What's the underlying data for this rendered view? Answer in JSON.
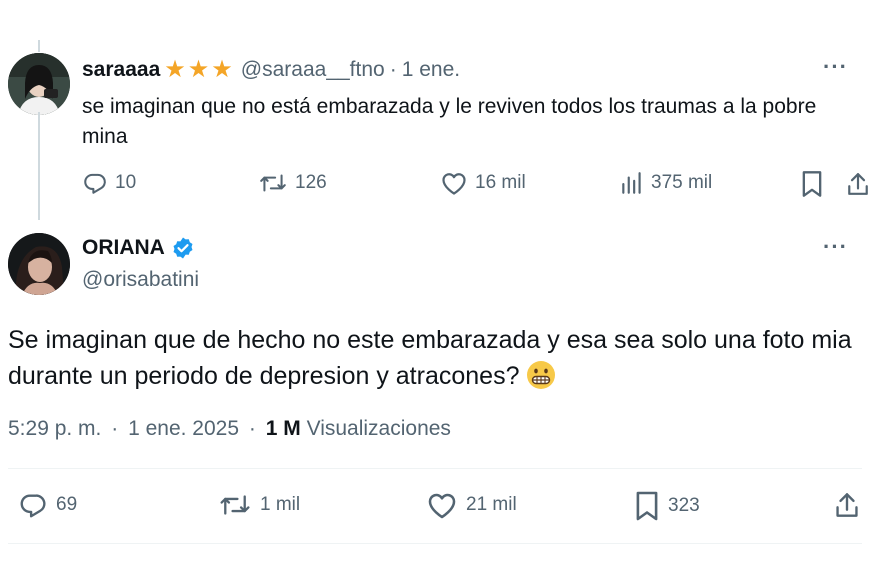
{
  "reply": {
    "name": "saraaaa",
    "stars": [
      "★",
      "★",
      "★"
    ],
    "handle": "@saraaa__ftno",
    "separator": "·",
    "date": "1 ene.",
    "text": "se imaginan que no está embarazada y le reviven todos los traumas a la pobre mina",
    "more_label": "···",
    "stats": {
      "replies": "10",
      "reposts": "126",
      "likes": "16 mil",
      "views": "375 mil"
    },
    "star_color": "#f4a527"
  },
  "tweet": {
    "name": "ORIANA",
    "handle": "@orisabatini",
    "text": "Se imaginan que de hecho no este embarazada y esa sea solo una foto mia durante un periodo de depresion y atracones?",
    "more_label": "···",
    "time": "5:29 p. m.",
    "date": "1 ene. 2025",
    "separator1": "·",
    "separator2": "·",
    "views_count": "1 M",
    "views_label": "Visualizaciones",
    "stats": {
      "replies": "69",
      "reposts": "1 mil",
      "likes": "21 mil",
      "bookmarks": "323"
    },
    "verified_color": "#1d9bf0"
  },
  "icons": {
    "reply": "reply-icon",
    "repost": "repost-icon",
    "like": "heart-icon",
    "views": "views-icon",
    "bookmark": "bookmark-icon",
    "share": "share-icon",
    "verified": "verified-badge-icon",
    "emoji": "grimacing-face-emoji"
  }
}
